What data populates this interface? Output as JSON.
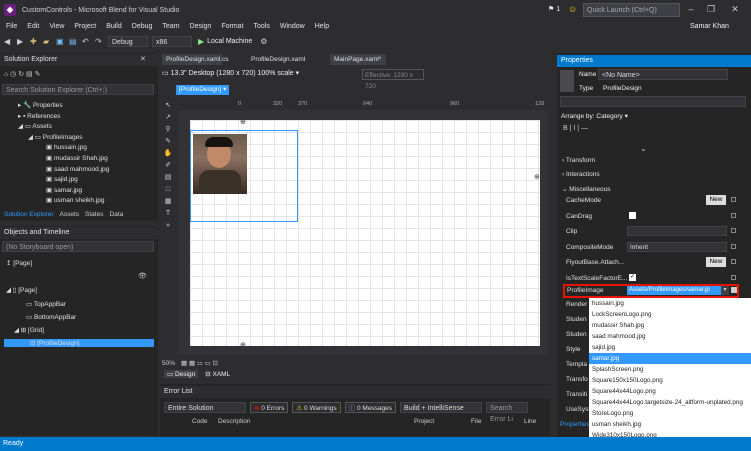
{
  "window": {
    "title": "CustomControls - Microsoft Blend for Visual Studio",
    "notification_count": "1",
    "quick_launch_placeholder": "Quick Launch (Ctrl+Q)",
    "user": "Samar Khan"
  },
  "menu": [
    "File",
    "Edit",
    "View",
    "Project",
    "Build",
    "Debug",
    "Team",
    "Design",
    "Format",
    "Tools",
    "Window",
    "Help"
  ],
  "toolbar": {
    "config": "Debug",
    "platform": "x86",
    "run_label": "Local Machine"
  },
  "solution_explorer": {
    "title": "Solution Explorer",
    "search_placeholder": "Search Solution Explorer (Ctrl+;)",
    "items": [
      "Properties",
      "References",
      "Assets",
      "ProfileImages",
      "hussain.jpg",
      "mudassir Shah.jpg",
      "saad mahmood.jpg",
      "sajid.jpg",
      "samar.jpg",
      "usman sheikh.jpg"
    ],
    "tabs": [
      "Solution Explorer",
      "Assets",
      "States",
      "Data"
    ]
  },
  "objects_timeline": {
    "title": "Objects and Timeline",
    "storyboard": "(No Storyboard open)",
    "page_top": "[Page]",
    "items": [
      "[Page]",
      "TopAppBar",
      "BottomAppBar",
      "[Grid]",
      "[ProfileDesign]"
    ]
  },
  "doc_tabs": [
    "ProfileDesign.xaml",
    "ProfileDesign.xaml.cs",
    "ProfileDesign.xaml",
    "MainPage.xaml*"
  ],
  "design": {
    "device": "13.3\" Desktop (1280 x 720) 100% scale",
    "effective": "Effective: 1280 x 720",
    "breadcrumb": "[ProfileDesign]",
    "ruler": [
      "0",
      "320",
      "370",
      "640",
      "960",
      "128"
    ],
    "zoom": "50%",
    "view_tabs": [
      "Design",
      "XAML"
    ]
  },
  "error_list": {
    "title": "Error List",
    "scope": "Entire Solution",
    "errors": "0 Errors",
    "warnings": "0 Warnings",
    "messages": "0 Messages",
    "build": "Build + IntelliSense",
    "search_placeholder": "Search Error Li",
    "columns": [
      "Code",
      "Description",
      "Project",
      "File",
      "Line"
    ]
  },
  "properties": {
    "title": "Properties",
    "name_label": "Name",
    "name_value": "<No Name>",
    "type_label": "Type",
    "type_value": "ProfileDesign",
    "arrange": "Arrange by: Category",
    "sections": [
      "Transform",
      "Interactions",
      "Miscellaneous"
    ],
    "rows": [
      {
        "label": "CacheMode",
        "value": "New"
      },
      {
        "label": "CanDrag",
        "value": ""
      },
      {
        "label": "Clip",
        "value": ""
      },
      {
        "label": "CompositeMode",
        "value": "Inherit"
      },
      {
        "label": "FlyoutBase.Attach...",
        "value": "New"
      },
      {
        "label": "IsTextScaleFactorE...",
        "value": ""
      }
    ],
    "profile_image_label": "ProfileImage",
    "profile_image_value": "Assets/ProfileImages/samar.jp",
    "truncated_rows": [
      "Render",
      "Studen",
      "Studen",
      "Style",
      "Templa",
      "Transfo",
      "Transiti",
      "UseSyst"
    ],
    "bottom_tab": "Properties"
  },
  "dropdown": {
    "options": [
      "hussain.jpg",
      "LockScreenLogo.png",
      "mudassir Shah.jpg",
      "saad mahmood.jpg",
      "sajid.jpg",
      "samar.jpg",
      "SplashScreen.png",
      "Square150x150Logo.png",
      "Square44x44Logo.png",
      "Square44x44Logo.targetsize-24_altform-unplated.png",
      "StoreLogo.png",
      "usman sheikh.jpg",
      "Wide310x150Logo.png"
    ],
    "selected": "samar.jpg"
  },
  "status": "Ready",
  "colors": {
    "accent": "#007acc",
    "highlight": "#e51400",
    "selection": "#3399ff"
  }
}
